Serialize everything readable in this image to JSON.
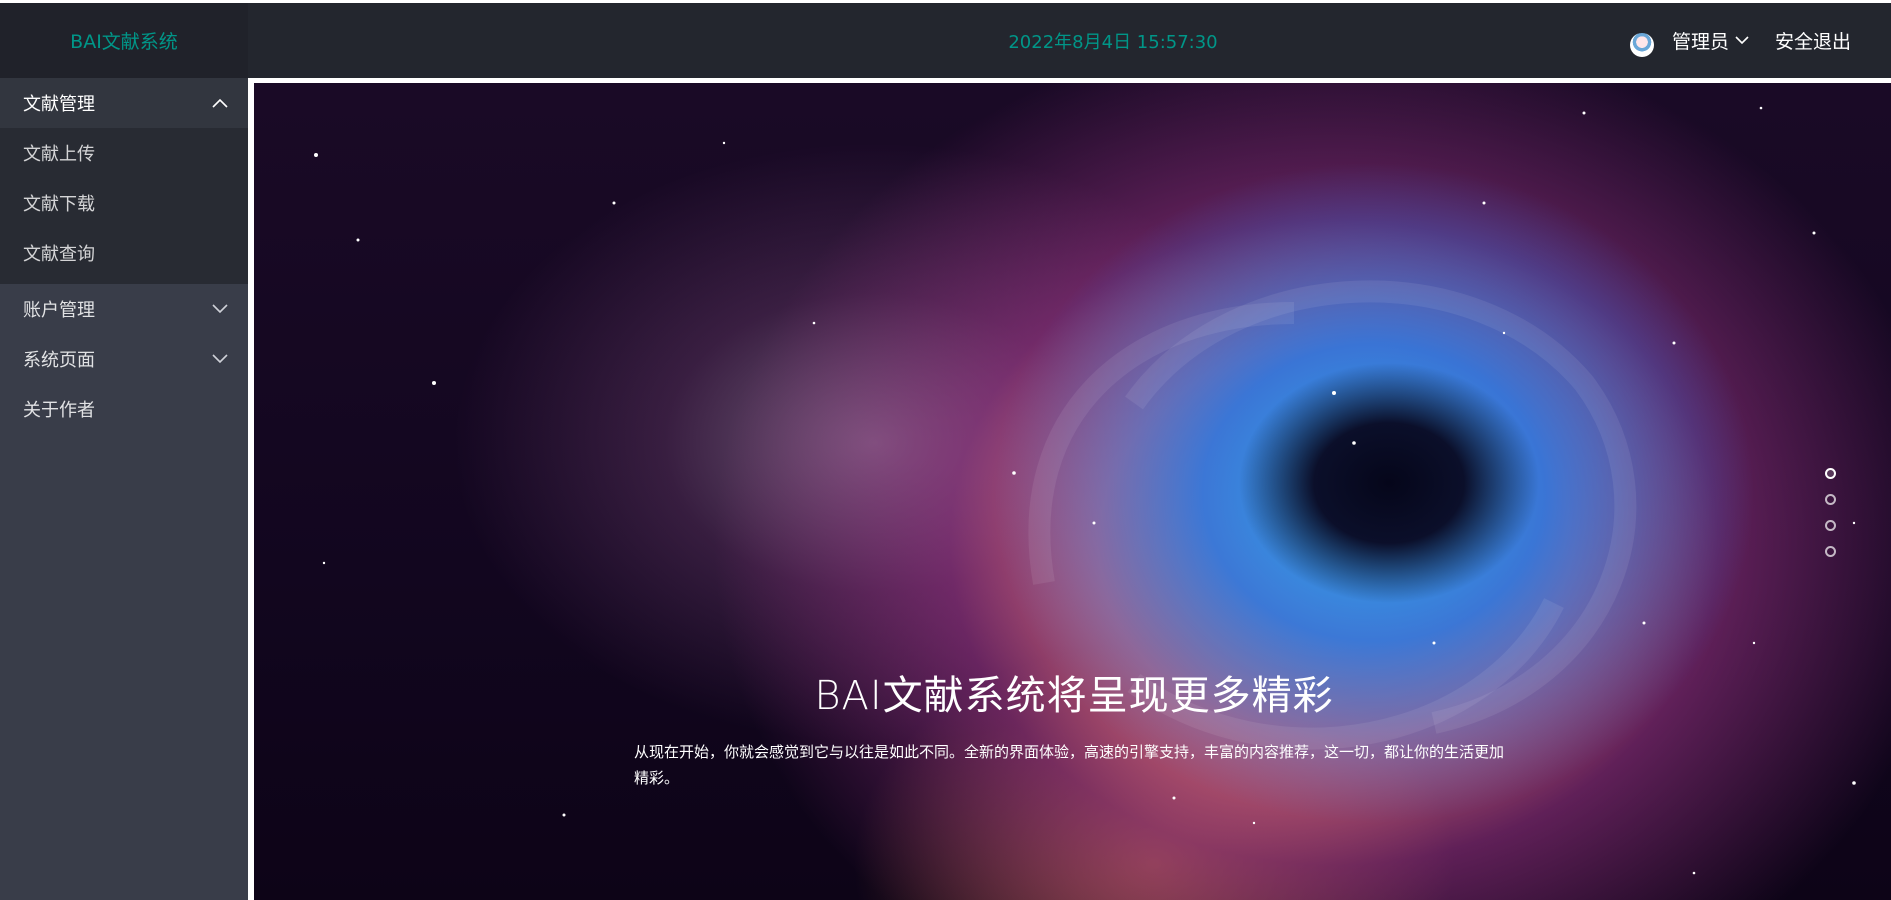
{
  "header": {
    "brand": "BAI文献系统",
    "datetime": "2022年8月4日 15:57:30",
    "user_label": "管理员",
    "logout_label": "安全退出"
  },
  "sidebar": {
    "groups": [
      {
        "label": "文献管理",
        "expanded": true,
        "children": [
          "文献上传",
          "文献下载",
          "文献查询"
        ]
      },
      {
        "label": "账户管理",
        "expanded": false
      },
      {
        "label": "系统页面",
        "expanded": false
      },
      {
        "label": "关于作者"
      }
    ]
  },
  "banner": {
    "title": "BAI文献系统将呈现更多精彩",
    "description": "从现在开始，你就会感觉到它与以往是如此不同。全新的界面体验，高速的引擎支持，丰富的内容推荐，这一切，都让你的生活更加精彩。",
    "slide_count": 4,
    "active_slide": 1
  },
  "colors": {
    "accent": "#009688",
    "header_bg": "#23262e",
    "sidebar_bg": "#393d49"
  },
  "icons": {
    "user_dropdown": "chevron-down-icon",
    "group_open": "chevron-up-icon",
    "group_closed": "chevron-down-icon"
  }
}
